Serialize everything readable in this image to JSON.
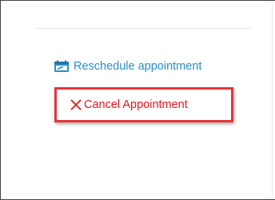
{
  "actions": {
    "reschedule": {
      "label": "Reschedule appointment",
      "icon": "calendar-reschedule-icon",
      "color": "#2a8fc7"
    },
    "cancel": {
      "label": "Cancel Appointment",
      "icon": "close-icon",
      "color": "#e0181f"
    }
  },
  "highlight": {
    "color": "#e8333a"
  }
}
